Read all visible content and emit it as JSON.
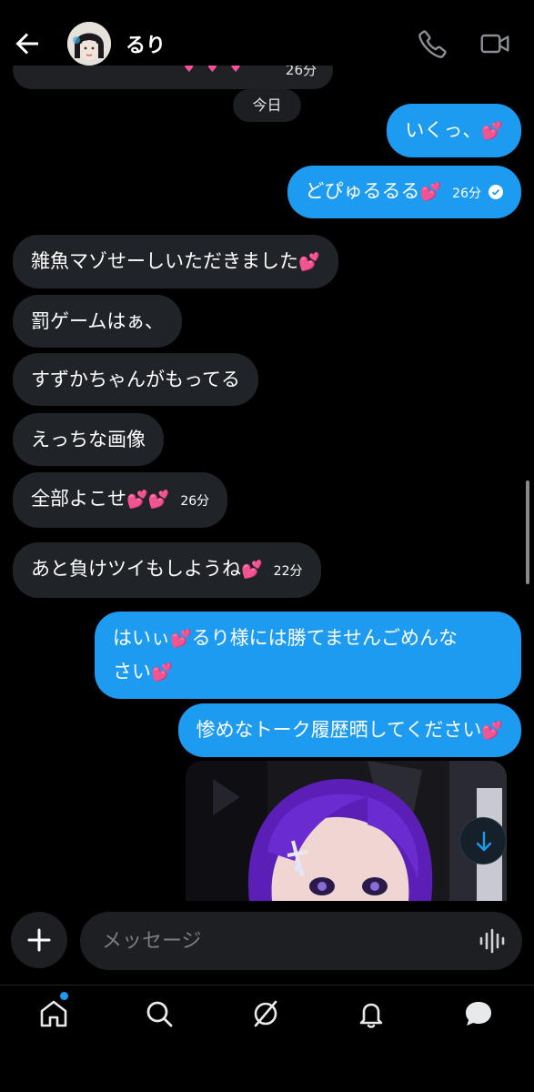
{
  "header": {
    "contact_name": "るり",
    "back_icon": "arrow-left-icon",
    "call_icon": "phone-icon",
    "video_icon": "video-camera-icon"
  },
  "conversation": {
    "previous_message_time": "26分",
    "date_separator": "今日",
    "messages": [
      {
        "side": "out",
        "text": "いくっ、",
        "heart": "💕"
      },
      {
        "side": "out",
        "text": "どぴゅるるる",
        "heart": "💕",
        "time": "26分",
        "status": "既読"
      },
      {
        "side": "in",
        "text": "雑魚マゾせーしいただきました",
        "heart": "💕"
      },
      {
        "side": "in",
        "text": "罰ゲームはぁ、"
      },
      {
        "side": "in",
        "text": "すずかちゃんがもってる"
      },
      {
        "side": "in",
        "text": "えっちな画像"
      },
      {
        "side": "in",
        "text": "全部よこせ",
        "heart": "💕💕",
        "time": "26分"
      },
      {
        "side": "in",
        "text": "あと負けツイもしようね",
        "heart": "💕",
        "time": "22分"
      },
      {
        "side": "out",
        "line1": "はいぃ",
        "heart1": "💕",
        "line1b": "るり様には勝てませんごめんな",
        "line2": "さい",
        "heart2": "💕"
      },
      {
        "side": "out",
        "text": "惨めなトーク履歴晒してください",
        "heart": "💕"
      }
    ]
  },
  "composer": {
    "placeholder": "メッセージ",
    "add_icon": "plus-icon",
    "voice_icon": "voice-waveform-icon"
  },
  "bottom_nav": {
    "items": [
      "home-icon",
      "search-icon",
      "grok-icon",
      "notifications-icon",
      "messages-icon"
    ],
    "home_has_notification_dot": true
  },
  "colors": {
    "accent": "#1d9bf0",
    "incoming_bubble": "#202327",
    "background": "#000000"
  }
}
